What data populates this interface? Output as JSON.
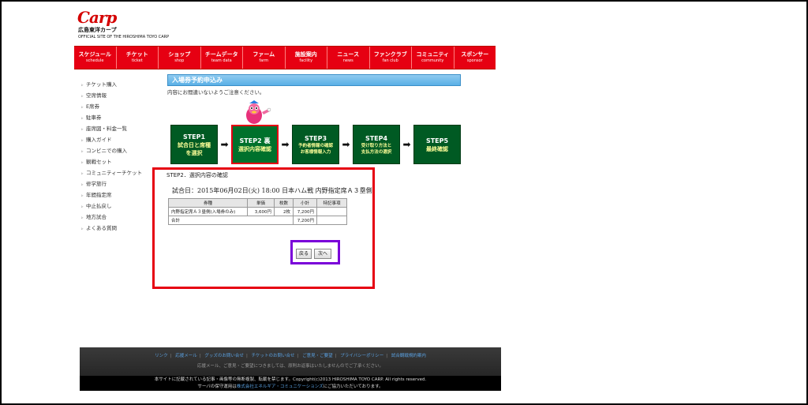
{
  "header": {
    "logo_text": "Carp",
    "site_name_jp": "広島東洋カープ",
    "site_name_en": "OFFICIAL SITE OF THE HIROSHIMA TOYO CARP"
  },
  "nav": [
    {
      "jp": "スケジュール",
      "en": "schedule"
    },
    {
      "jp": "チケット",
      "en": "ticket"
    },
    {
      "jp": "ショップ",
      "en": "shop"
    },
    {
      "jp": "チームデータ",
      "en": "team data"
    },
    {
      "jp": "ファーム",
      "en": "farm"
    },
    {
      "jp": "施設案内",
      "en": "facility"
    },
    {
      "jp": "ニュース",
      "en": "news"
    },
    {
      "jp": "ファンクラブ",
      "en": "fan club"
    },
    {
      "jp": "コミュニティ",
      "en": "community"
    },
    {
      "jp": "スポンサー",
      "en": "sponsor"
    }
  ],
  "sidebar": [
    "チケット購入",
    "空席情報",
    "E席券",
    "駐車券",
    "座席図・料金一覧",
    "購入ガイド",
    "コンビニでの購入",
    "観戦セット",
    "コミュニティーチケット",
    "修学旅行",
    "年間指定席",
    "中止払戻し",
    "地方試合",
    "よくある質問"
  ],
  "main": {
    "heading": "入場券予約申込み",
    "notice": "内容にお間違いないようご注意ください。",
    "steps": [
      {
        "num": "STEP1",
        "lines": [
          "試合日と席種",
          "を選択"
        ]
      },
      {
        "num": "STEP2 裏",
        "lines": [
          "選択内容確認"
        ]
      },
      {
        "num": "STEP3",
        "lines": [
          "予約者情報の確認",
          "お客様情報入力"
        ]
      },
      {
        "num": "STEP4",
        "lines": [
          "受け取り方法と",
          "支払方法の選択"
        ]
      },
      {
        "num": "STEP5",
        "lines": [
          "最終確認"
        ]
      }
    ],
    "step_caption": "STEP2．選択内容の確認",
    "game_title": "試合日：2015年06月02日(火) 18:00 日本ハム戦 内野指定席Ａ３塁側",
    "table": {
      "headers": [
        "券種",
        "単価",
        "枚数",
        "小計",
        "特記事項"
      ],
      "rows": [
        [
          "内野指定席Ａ３塁側(入場券のみ)",
          "3,600円",
          "2枚",
          "7,200円",
          ""
        ]
      ],
      "total_label": "合計",
      "total_value": "7,200円"
    },
    "buttons": {
      "back": "戻る",
      "next": "次へ"
    }
  },
  "footer": {
    "links": [
      "リンク",
      "応援メール",
      "グッズのお問い合せ",
      "チケットのお問い合せ",
      "ご意見・ご要望",
      "プライバシーポリシー",
      "試合観戦規約案内"
    ],
    "note": "応援メール、ご意見・ご要望につきましては、原則お返事はいたしませんのでご了承ください。",
    "copyright": "本サイトに記載されている記事・画像等の無断複製、転載を禁じます。Copyright(c)2013 HIROSHIMA TOYO CARP. All rights reserved.",
    "server_prefix": "サーバの保守運用は",
    "server_link": "株式会社エネルギア・コミュニケーションズ",
    "server_suffix": "にご協力いただいております。"
  },
  "colors": {
    "brand_red": "#e60012",
    "step_green": "#005a23",
    "heading_blue": "#5ab0e6",
    "highlight_purple": "#7a00d9"
  }
}
